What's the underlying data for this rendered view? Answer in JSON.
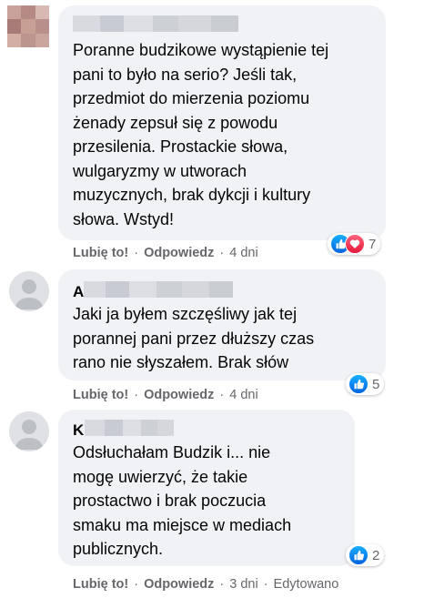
{
  "comments": [
    {
      "text": "Poranne budzikowe wystąpienie tej\npani to było na serio? Jeśli tak,\nprzedmiot do mierzenia poziomu\nżenady zepsuł się z powodu\nprzesilenia. Prostackie słowa,\nwulgaryzmy w utworach\nmuzycznych, brak dykcji i kultury\nsłowa. Wstyd!",
      "like_label": "Lubię to!",
      "reply_label": "Odpowiedz",
      "time": "4 dni",
      "reaction_count": "7",
      "reactions": [
        "like-icon",
        "love-icon"
      ]
    },
    {
      "initial": "A",
      "text": "Jaki ja byłem szczęśliwy jak tej\nporannej pani przez dłuższy czas\nrano nie słyszałem. Brak słów",
      "like_label": "Lubię to!",
      "reply_label": "Odpowiedz",
      "time": "4 dni",
      "reaction_count": "5",
      "reactions": [
        "like-icon"
      ]
    },
    {
      "initial": "K",
      "text": "Odsłuchałam Budzik i... nie\nmogę uwierzyć, że takie\nprostactwo i brak poczucia\nsmaku ma miejsce w mediach\npublicznych.",
      "like_label": "Lubię to!",
      "reply_label": "Odpowiedz",
      "time": "3 dni",
      "edited": "Edytowano",
      "reaction_count": "2",
      "reactions": [
        "like-icon"
      ]
    }
  ],
  "colors": {
    "bubble": "#f0f2f5",
    "meta_text": "#65676b",
    "like_blue": "#1877f2",
    "love_red": "#f33e58"
  }
}
